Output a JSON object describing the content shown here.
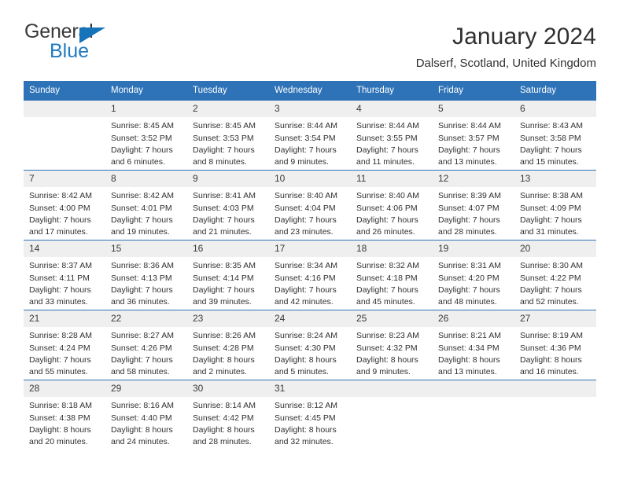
{
  "brand": {
    "name_part1": "General",
    "name_part2": "Blue",
    "accent_color": "#1f7ac1",
    "triangle_color": "#1573b9"
  },
  "header": {
    "title": "January 2024",
    "location": "Dalserf, Scotland, United Kingdom"
  },
  "calendar": {
    "header_bg": "#2e73b8",
    "daynum_bg": "#efefef",
    "weekdays": [
      "Sunday",
      "Monday",
      "Tuesday",
      "Wednesday",
      "Thursday",
      "Friday",
      "Saturday"
    ],
    "weeks": [
      [
        {
          "day": "",
          "empty": true,
          "sunrise": "",
          "sunset": "",
          "daylight_line1": "",
          "daylight_line2": ""
        },
        {
          "day": "1",
          "sunrise": "Sunrise: 8:45 AM",
          "sunset": "Sunset: 3:52 PM",
          "daylight_line1": "Daylight: 7 hours",
          "daylight_line2": "and 6 minutes."
        },
        {
          "day": "2",
          "sunrise": "Sunrise: 8:45 AM",
          "sunset": "Sunset: 3:53 PM",
          "daylight_line1": "Daylight: 7 hours",
          "daylight_line2": "and 8 minutes."
        },
        {
          "day": "3",
          "sunrise": "Sunrise: 8:44 AM",
          "sunset": "Sunset: 3:54 PM",
          "daylight_line1": "Daylight: 7 hours",
          "daylight_line2": "and 9 minutes."
        },
        {
          "day": "4",
          "sunrise": "Sunrise: 8:44 AM",
          "sunset": "Sunset: 3:55 PM",
          "daylight_line1": "Daylight: 7 hours",
          "daylight_line2": "and 11 minutes."
        },
        {
          "day": "5",
          "sunrise": "Sunrise: 8:44 AM",
          "sunset": "Sunset: 3:57 PM",
          "daylight_line1": "Daylight: 7 hours",
          "daylight_line2": "and 13 minutes."
        },
        {
          "day": "6",
          "sunrise": "Sunrise: 8:43 AM",
          "sunset": "Sunset: 3:58 PM",
          "daylight_line1": "Daylight: 7 hours",
          "daylight_line2": "and 15 minutes."
        }
      ],
      [
        {
          "day": "7",
          "sunrise": "Sunrise: 8:42 AM",
          "sunset": "Sunset: 4:00 PM",
          "daylight_line1": "Daylight: 7 hours",
          "daylight_line2": "and 17 minutes."
        },
        {
          "day": "8",
          "sunrise": "Sunrise: 8:42 AM",
          "sunset": "Sunset: 4:01 PM",
          "daylight_line1": "Daylight: 7 hours",
          "daylight_line2": "and 19 minutes."
        },
        {
          "day": "9",
          "sunrise": "Sunrise: 8:41 AM",
          "sunset": "Sunset: 4:03 PM",
          "daylight_line1": "Daylight: 7 hours",
          "daylight_line2": "and 21 minutes."
        },
        {
          "day": "10",
          "sunrise": "Sunrise: 8:40 AM",
          "sunset": "Sunset: 4:04 PM",
          "daylight_line1": "Daylight: 7 hours",
          "daylight_line2": "and 23 minutes."
        },
        {
          "day": "11",
          "sunrise": "Sunrise: 8:40 AM",
          "sunset": "Sunset: 4:06 PM",
          "daylight_line1": "Daylight: 7 hours",
          "daylight_line2": "and 26 minutes."
        },
        {
          "day": "12",
          "sunrise": "Sunrise: 8:39 AM",
          "sunset": "Sunset: 4:07 PM",
          "daylight_line1": "Daylight: 7 hours",
          "daylight_line2": "and 28 minutes."
        },
        {
          "day": "13",
          "sunrise": "Sunrise: 8:38 AM",
          "sunset": "Sunset: 4:09 PM",
          "daylight_line1": "Daylight: 7 hours",
          "daylight_line2": "and 31 minutes."
        }
      ],
      [
        {
          "day": "14",
          "sunrise": "Sunrise: 8:37 AM",
          "sunset": "Sunset: 4:11 PM",
          "daylight_line1": "Daylight: 7 hours",
          "daylight_line2": "and 33 minutes."
        },
        {
          "day": "15",
          "sunrise": "Sunrise: 8:36 AM",
          "sunset": "Sunset: 4:13 PM",
          "daylight_line1": "Daylight: 7 hours",
          "daylight_line2": "and 36 minutes."
        },
        {
          "day": "16",
          "sunrise": "Sunrise: 8:35 AM",
          "sunset": "Sunset: 4:14 PM",
          "daylight_line1": "Daylight: 7 hours",
          "daylight_line2": "and 39 minutes."
        },
        {
          "day": "17",
          "sunrise": "Sunrise: 8:34 AM",
          "sunset": "Sunset: 4:16 PM",
          "daylight_line1": "Daylight: 7 hours",
          "daylight_line2": "and 42 minutes."
        },
        {
          "day": "18",
          "sunrise": "Sunrise: 8:32 AM",
          "sunset": "Sunset: 4:18 PM",
          "daylight_line1": "Daylight: 7 hours",
          "daylight_line2": "and 45 minutes."
        },
        {
          "day": "19",
          "sunrise": "Sunrise: 8:31 AM",
          "sunset": "Sunset: 4:20 PM",
          "daylight_line1": "Daylight: 7 hours",
          "daylight_line2": "and 48 minutes."
        },
        {
          "day": "20",
          "sunrise": "Sunrise: 8:30 AM",
          "sunset": "Sunset: 4:22 PM",
          "daylight_line1": "Daylight: 7 hours",
          "daylight_line2": "and 52 minutes."
        }
      ],
      [
        {
          "day": "21",
          "sunrise": "Sunrise: 8:28 AM",
          "sunset": "Sunset: 4:24 PM",
          "daylight_line1": "Daylight: 7 hours",
          "daylight_line2": "and 55 minutes."
        },
        {
          "day": "22",
          "sunrise": "Sunrise: 8:27 AM",
          "sunset": "Sunset: 4:26 PM",
          "daylight_line1": "Daylight: 7 hours",
          "daylight_line2": "and 58 minutes."
        },
        {
          "day": "23",
          "sunrise": "Sunrise: 8:26 AM",
          "sunset": "Sunset: 4:28 PM",
          "daylight_line1": "Daylight: 8 hours",
          "daylight_line2": "and 2 minutes."
        },
        {
          "day": "24",
          "sunrise": "Sunrise: 8:24 AM",
          "sunset": "Sunset: 4:30 PM",
          "daylight_line1": "Daylight: 8 hours",
          "daylight_line2": "and 5 minutes."
        },
        {
          "day": "25",
          "sunrise": "Sunrise: 8:23 AM",
          "sunset": "Sunset: 4:32 PM",
          "daylight_line1": "Daylight: 8 hours",
          "daylight_line2": "and 9 minutes."
        },
        {
          "day": "26",
          "sunrise": "Sunrise: 8:21 AM",
          "sunset": "Sunset: 4:34 PM",
          "daylight_line1": "Daylight: 8 hours",
          "daylight_line2": "and 13 minutes."
        },
        {
          "day": "27",
          "sunrise": "Sunrise: 8:19 AM",
          "sunset": "Sunset: 4:36 PM",
          "daylight_line1": "Daylight: 8 hours",
          "daylight_line2": "and 16 minutes."
        }
      ],
      [
        {
          "day": "28",
          "sunrise": "Sunrise: 8:18 AM",
          "sunset": "Sunset: 4:38 PM",
          "daylight_line1": "Daylight: 8 hours",
          "daylight_line2": "and 20 minutes."
        },
        {
          "day": "29",
          "sunrise": "Sunrise: 8:16 AM",
          "sunset": "Sunset: 4:40 PM",
          "daylight_line1": "Daylight: 8 hours",
          "daylight_line2": "and 24 minutes."
        },
        {
          "day": "30",
          "sunrise": "Sunrise: 8:14 AM",
          "sunset": "Sunset: 4:42 PM",
          "daylight_line1": "Daylight: 8 hours",
          "daylight_line2": "and 28 minutes."
        },
        {
          "day": "31",
          "sunrise": "Sunrise: 8:12 AM",
          "sunset": "Sunset: 4:45 PM",
          "daylight_line1": "Daylight: 8 hours",
          "daylight_line2": "and 32 minutes."
        },
        {
          "day": "",
          "empty": true,
          "sunrise": "",
          "sunset": "",
          "daylight_line1": "",
          "daylight_line2": ""
        },
        {
          "day": "",
          "empty": true,
          "sunrise": "",
          "sunset": "",
          "daylight_line1": "",
          "daylight_line2": ""
        },
        {
          "day": "",
          "empty": true,
          "sunrise": "",
          "sunset": "",
          "daylight_line1": "",
          "daylight_line2": ""
        }
      ]
    ]
  }
}
